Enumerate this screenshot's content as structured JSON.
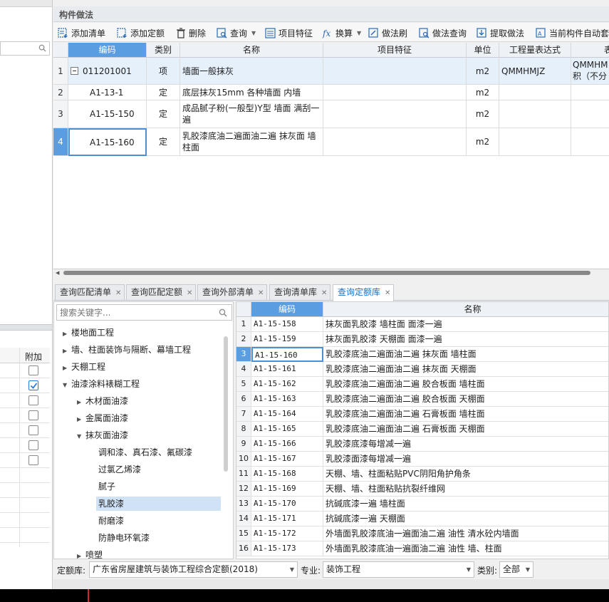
{
  "panel_title": "构件做法",
  "toolbar": [
    {
      "label": "添加清单",
      "icon": "add-list-icon"
    },
    {
      "label": "添加定额",
      "icon": "add-quota-icon"
    },
    {
      "label": "删除",
      "icon": "trash-icon"
    },
    {
      "label": "查询",
      "icon": "query-icon",
      "dropdown": true
    },
    {
      "label": "项目特征",
      "icon": "feature-icon"
    },
    {
      "label": "换算",
      "icon": "fx-icon",
      "dropdown": true
    },
    {
      "label": "做法刷",
      "icon": "brush-icon"
    },
    {
      "label": "做法查询",
      "icon": "method-query-icon"
    },
    {
      "label": "提取做法",
      "icon": "extract-icon"
    },
    {
      "label": "当前构件自动套",
      "icon": "auto-apply-icon"
    }
  ],
  "top_grid": {
    "headers": [
      "编码",
      "类别",
      "名称",
      "项目特征",
      "单位",
      "工程量表达式",
      "表"
    ],
    "rows": [
      {
        "num": "1",
        "code": "011201001",
        "type": "项",
        "name": "墙面一般抹灰",
        "feature": "",
        "unit": "m2",
        "expr": "QMMHMJZ",
        "extra": "QMMHM 积（不分"
      },
      {
        "num": "2",
        "code": "A1-13-1",
        "type": "定",
        "name": "底层抹灰15mm 各种墙面 内墙",
        "feature": "",
        "unit": "m2",
        "expr": "",
        "extra": ""
      },
      {
        "num": "3",
        "code": "A1-15-150",
        "type": "定",
        "name": "成品腻子粉(一般型)Y型 墙面 满刮一遍",
        "feature": "",
        "unit": "m2",
        "expr": "",
        "extra": ""
      },
      {
        "num": "4",
        "code": "A1-15-160",
        "type": "定",
        "name": "乳胶漆底油二遍面油二遍 抹灰面 墙柱面",
        "feature": "",
        "unit": "m2",
        "expr": "",
        "extra": ""
      }
    ]
  },
  "tabs": [
    {
      "label": "查询匹配清单"
    },
    {
      "label": "查询匹配定额"
    },
    {
      "label": "查询外部清单"
    },
    {
      "label": "查询清单库"
    },
    {
      "label": "查询定额库",
      "active": true
    }
  ],
  "tree": {
    "search_placeholder": "搜索关键字...",
    "items": [
      {
        "label": "楼地面工程",
        "level": 0,
        "caret": "right"
      },
      {
        "label": "墙、柱面装饰与隔断、幕墙工程",
        "level": 0,
        "caret": "right"
      },
      {
        "label": "天棚工程",
        "level": 0,
        "caret": "right"
      },
      {
        "label": "油漆涂料裱糊工程",
        "level": 0,
        "caret": "down"
      },
      {
        "label": "木材面油漆",
        "level": 1,
        "caret": "right"
      },
      {
        "label": "金属面油漆",
        "level": 1,
        "caret": "right"
      },
      {
        "label": "抹灰面油漆",
        "level": 1,
        "caret": "down"
      },
      {
        "label": "调和漆、真石漆、氟碳漆",
        "level": 2,
        "caret": ""
      },
      {
        "label": "过氯乙烯漆",
        "level": 2,
        "caret": ""
      },
      {
        "label": "腻子",
        "level": 2,
        "caret": ""
      },
      {
        "label": "乳胶漆",
        "level": 2,
        "caret": "",
        "selected": true
      },
      {
        "label": "耐磨漆",
        "level": 2,
        "caret": ""
      },
      {
        "label": "防静电环氧漆",
        "level": 2,
        "caret": ""
      },
      {
        "label": "喷塑",
        "level": 1,
        "caret": "right"
      }
    ]
  },
  "results": {
    "headers": [
      "编码",
      "名称"
    ],
    "rows": [
      {
        "num": "1",
        "code": "A1-15-158",
        "name": "抹灰面乳胶漆 墙柱面 面漆一遍"
      },
      {
        "num": "2",
        "code": "A1-15-159",
        "name": "抹灰面乳胶漆 天棚面 面漆一遍"
      },
      {
        "num": "3",
        "code": "A1-15-160",
        "name": "乳胶漆底油二遍面油二遍 抹灰面 墙柱面",
        "selected": true
      },
      {
        "num": "4",
        "code": "A1-15-161",
        "name": "乳胶漆底油二遍面油二遍 抹灰面 天棚面"
      },
      {
        "num": "5",
        "code": "A1-15-162",
        "name": "乳胶漆底油二遍面油二遍 胶合板面 墙柱面"
      },
      {
        "num": "6",
        "code": "A1-15-163",
        "name": "乳胶漆底油二遍面油二遍 胶合板面 天棚面"
      },
      {
        "num": "7",
        "code": "A1-15-164",
        "name": "乳胶漆底油二遍面油二遍 石膏板面 墙柱面"
      },
      {
        "num": "8",
        "code": "A1-15-165",
        "name": "乳胶漆底油二遍面油二遍 石膏板面 天棚面"
      },
      {
        "num": "9",
        "code": "A1-15-166",
        "name": "乳胶漆底漆每增减一遍"
      },
      {
        "num": "10",
        "code": "A1-15-167",
        "name": "乳胶漆面漆每增减一遍"
      },
      {
        "num": "11",
        "code": "A1-15-168",
        "name": "天棚、墙、柱面粘贴PVC阴阳角护角条"
      },
      {
        "num": "12",
        "code": "A1-15-169",
        "name": "天棚、墙、柱面粘贴抗裂纤维网"
      },
      {
        "num": "13",
        "code": "A1-15-170",
        "name": "抗碱底漆一遍 墙柱面"
      },
      {
        "num": "14",
        "code": "A1-15-171",
        "name": "抗碱底漆一遍 天棚面"
      },
      {
        "num": "15",
        "code": "A1-15-172",
        "name": "外墙面乳胶漆底油一遍面油二遍 油性 清水砼内墙面"
      },
      {
        "num": "16",
        "code": "A1-15-173",
        "name": "外墙面乳胶漆底油一遍面油二遍 油性 墙、柱面"
      }
    ]
  },
  "filter": {
    "quota_label": "定额库:",
    "quota_value": "广东省房屋建筑与装饰工程综合定额(2018)",
    "major_label": "专业:",
    "major_value": "装饰工程",
    "category_label": "类别:",
    "category_value": "全部"
  },
  "left_panel": {
    "column_label": "附加",
    "checkboxes": [
      false,
      true,
      false,
      false,
      false,
      false,
      false
    ]
  },
  "colors": {
    "accent": "#5a9de0",
    "selected_tab_text": "#1a6fc8",
    "tree_selected": "#cfe2f6"
  }
}
